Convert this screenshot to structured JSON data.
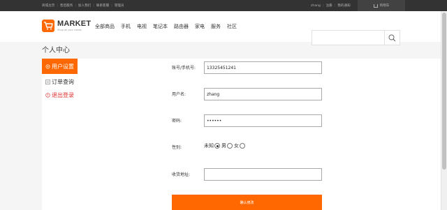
{
  "topbar": {
    "links": [
      "商城主页",
      "售后服务",
      "加入我们",
      "联系客服",
      "管理员"
    ],
    "user": "zhang",
    "register": "注册",
    "orders": "我的通知",
    "cart": "购物车"
  },
  "header": {
    "logo_text": "MARKET",
    "logo_sub": "Shop all your needs",
    "nav": [
      "全部商品",
      "手机",
      "电视",
      "笔记本",
      "路由器",
      "家电",
      "服务",
      "社区"
    ],
    "search_placeholder": ""
  },
  "page_title": "个人中心",
  "sidebar": {
    "items": [
      {
        "label": "用户设置",
        "icon": "gear-icon",
        "active": true
      },
      {
        "label": "订单查询",
        "icon": "list-icon",
        "active": false
      },
      {
        "label": "退出登录",
        "icon": "exit-icon",
        "active": false
      }
    ]
  },
  "form": {
    "account_label": "账号/手机号:",
    "account_value": "13325451241",
    "username_label": "用户名:",
    "username_value": "zhang",
    "password_label": "密码:",
    "password_value": "••••••",
    "gender_label": "性别:",
    "gender_options": [
      "未知",
      "男",
      "女"
    ],
    "gender_selected": "未知",
    "address_label": "收货地址:",
    "address_value": "",
    "submit_label": "确认修改"
  },
  "colors": {
    "accent": "#ff6700",
    "topbar": "#333333",
    "logout": "#e03030"
  }
}
